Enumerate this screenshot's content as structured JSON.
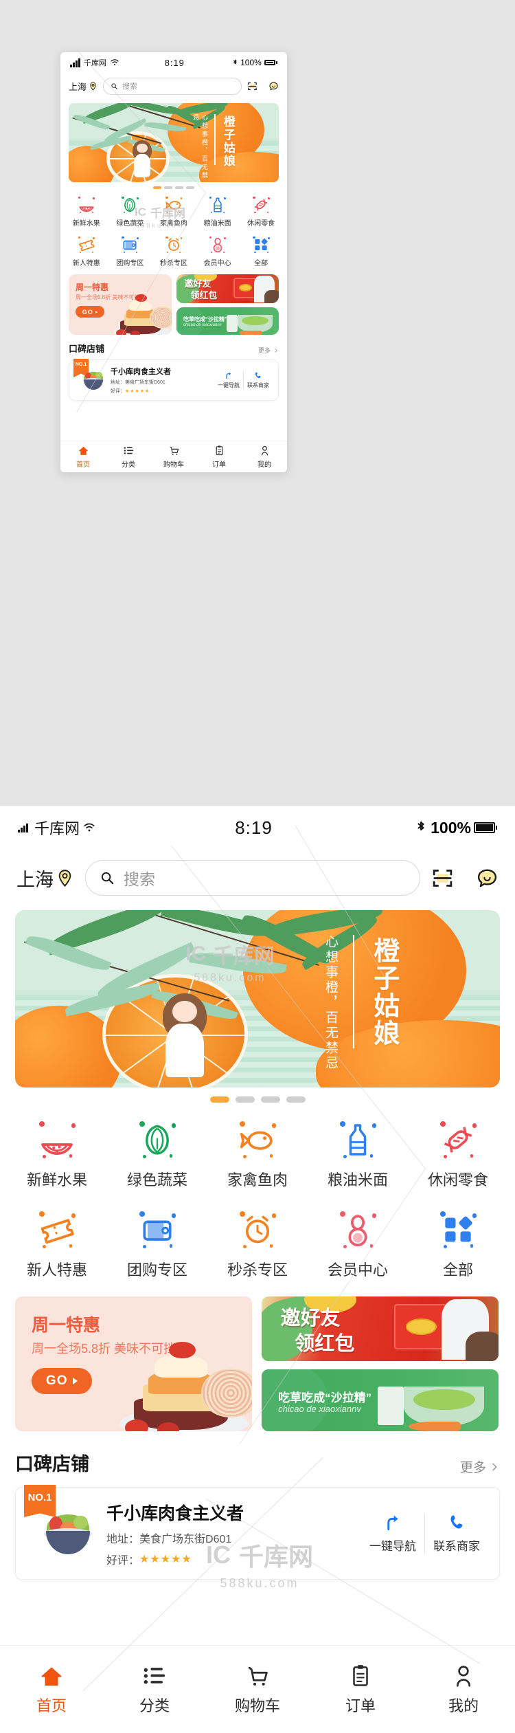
{
  "status_bar": {
    "carrier": "千库网",
    "time": "8:19",
    "battery_percent": "100%",
    "signal_icon": "signal-bars-icon",
    "wifi_icon": "wifi-icon",
    "bluetooth_icon": "bluetooth-icon",
    "battery_icon": "battery-icon"
  },
  "header": {
    "city": "上海",
    "location_icon": "location-pin-icon",
    "search_placeholder": "搜索",
    "search_icon": "search-icon",
    "scan_icon": "scan-code-icon",
    "message_icon": "message-bubble-icon"
  },
  "hero": {
    "title": "橙子姑娘",
    "subtitle": "心想事橙，百无禁忌",
    "dots_total": 4,
    "dots_active_index": 0,
    "accent": "#fdaa3c"
  },
  "category_rows": [
    [
      {
        "label": "新鲜水果",
        "icon": "watermelon-icon",
        "color": "#ef4b52"
      },
      {
        "label": "绿色蔬菜",
        "icon": "cabbage-icon",
        "color": "#17a65a"
      },
      {
        "label": "家禽鱼肉",
        "icon": "fish-icon",
        "color": "#f58220"
      },
      {
        "label": "粮油米面",
        "icon": "oil-bottle-icon",
        "color": "#2f80ed"
      },
      {
        "label": "休闲零食",
        "icon": "candy-icon",
        "color": "#ef4b52"
      }
    ],
    [
      {
        "label": "新人特惠",
        "icon": "ticket-icon",
        "color": "#f58220"
      },
      {
        "label": "团购专区",
        "icon": "wallet-icon",
        "color": "#2f80ed"
      },
      {
        "label": "秒杀专区",
        "icon": "alarm-clock-icon",
        "color": "#f58220"
      },
      {
        "label": "会员中心",
        "icon": "member-person-icon",
        "color": "#ef5b6d"
      },
      {
        "label": "全部",
        "icon": "all-grid-icon",
        "color": "#2f80ed"
      }
    ]
  ],
  "promos": {
    "left": {
      "title": "周一特惠",
      "subtitle": "周一全场5.8折  美味不可挡",
      "button_label": "GO",
      "button_arrow": "chevron-right-icon",
      "bg": "#fbe4dc",
      "accent": "#f06523"
    },
    "right_top": {
      "line1": "邀好友",
      "line2": "领红包"
    },
    "right_bottom": {
      "line1": "吃草吃成“沙拉精”",
      "line2": "chicao de xiaoxiannv"
    }
  },
  "shop_section": {
    "title": "口碑店铺",
    "more_label": "更多",
    "more_icon": "chevron-right-icon",
    "card": {
      "rank_badge": "NO.1",
      "thumb_icon": "salad-bowl-icon",
      "name": "千小库肉食主义者",
      "address_label": "地址：",
      "address_value": "美食广场东街D601",
      "rating_label": "好评：",
      "stars": "★★★★★",
      "actions": [
        {
          "label": "一键导航",
          "icon": "navigation-arrow-icon"
        },
        {
          "label": "联系商家",
          "icon": "phone-icon"
        }
      ]
    }
  },
  "tabbar": {
    "items": [
      {
        "label": "首页",
        "icon": "home-icon",
        "active": true
      },
      {
        "label": "分类",
        "icon": "list-icon",
        "active": false
      },
      {
        "label": "购物车",
        "icon": "cart-icon",
        "active": false
      },
      {
        "label": "订单",
        "icon": "order-clipboard-icon",
        "active": false
      },
      {
        "label": "我的",
        "icon": "user-icon",
        "active": false
      }
    ]
  },
  "watermark": {
    "brand": "千库网",
    "domain": "588ku.com",
    "logo": "IC"
  }
}
